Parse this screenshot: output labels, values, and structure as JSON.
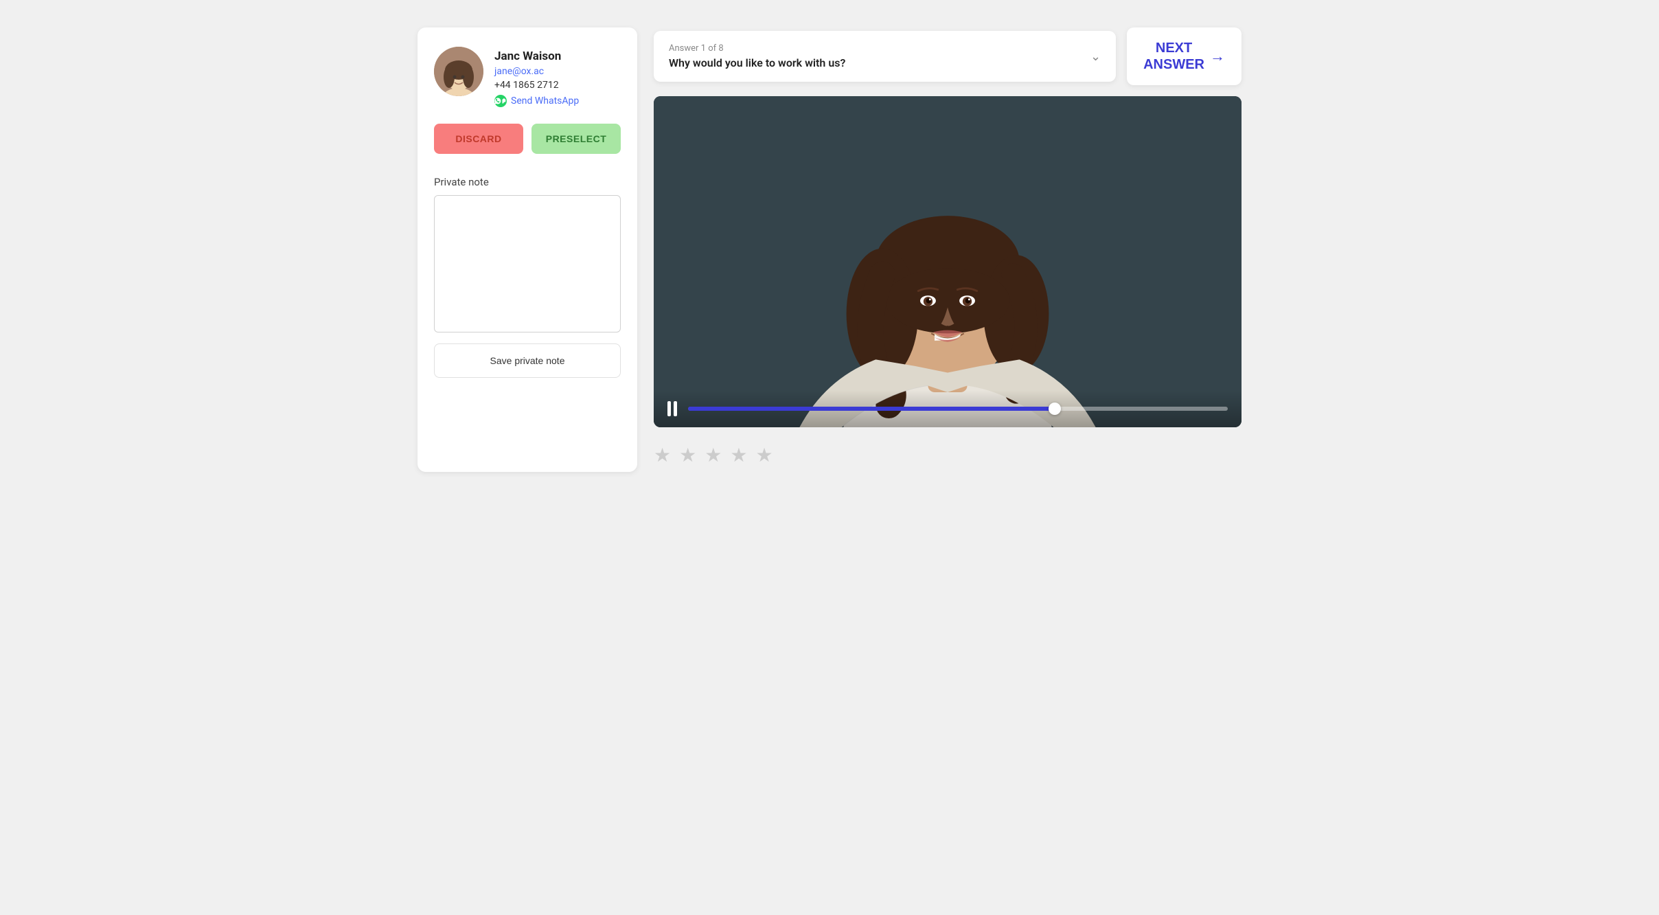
{
  "leftPanel": {
    "profile": {
      "name": "Janc Waison",
      "email": "jane@ox.ac",
      "phone": "+44 1865 2712",
      "whatsapp_label": "Send WhatsApp"
    },
    "buttons": {
      "discard": "DISCARD",
      "preselect": "PRESELECT"
    },
    "privateNote": {
      "label": "Private note",
      "placeholder": "",
      "save_button": "Save private note"
    }
  },
  "rightPanel": {
    "answerCard": {
      "counter": "Answer 1 of 8",
      "question": "Why would you like to work with us?"
    },
    "nextAnswer": {
      "line1": "NEXT",
      "line2": "ANSWER"
    },
    "video": {
      "progress_percent": 68
    },
    "stars": [
      {
        "filled": false
      },
      {
        "filled": false
      },
      {
        "filled": false
      },
      {
        "filled": false
      },
      {
        "filled": false
      }
    ]
  }
}
